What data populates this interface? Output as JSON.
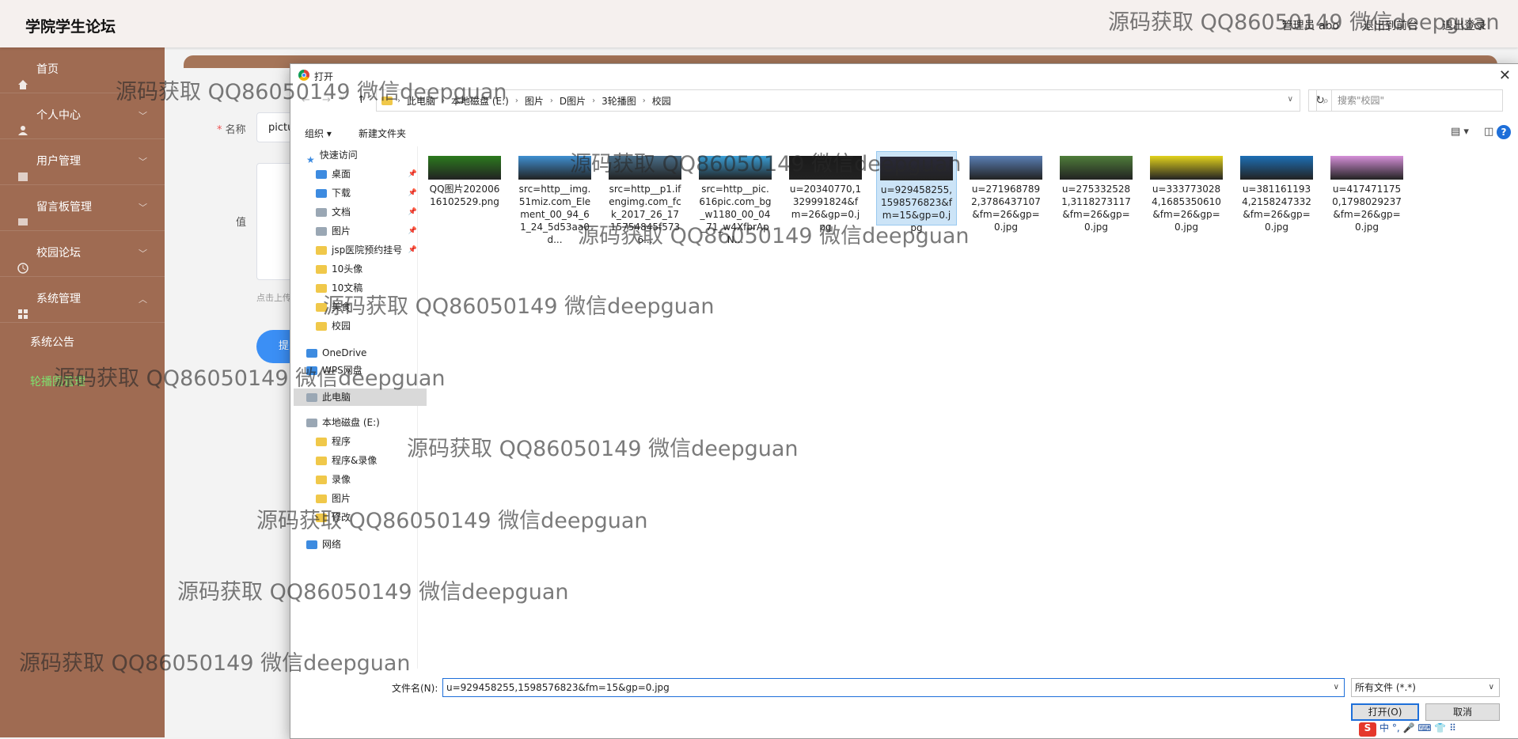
{
  "app": {
    "title": "学院学生论坛"
  },
  "topnav": {
    "user": "管理员 abo",
    "back_to_front": "退出到前台",
    "logout": "退出登录"
  },
  "sidebar": {
    "items": [
      {
        "label": "首页",
        "icon": "home-icon"
      },
      {
        "label": "个人中心",
        "icon": "user-icon"
      },
      {
        "label": "用户管理",
        "icon": "users-icon"
      },
      {
        "label": "留言板管理",
        "icon": "message-icon"
      },
      {
        "label": "校园论坛",
        "icon": "forum-icon"
      },
      {
        "label": "系统管理",
        "icon": "grid-icon"
      }
    ],
    "sub_items": [
      {
        "label": "系统公告",
        "active": false
      },
      {
        "label": "轮播图管理",
        "active": true
      }
    ]
  },
  "form": {
    "name_label": "名称",
    "name_value": "pictu",
    "value_label": "值",
    "upload_hint": "点击上传",
    "submit_label": "提"
  },
  "dialog": {
    "title": "打开",
    "breadcrumb": [
      "此电脑",
      "本地磁盘 (E:)",
      "图片",
      "D图片",
      "3轮播图",
      "校园"
    ],
    "search_placeholder": "搜索\"校园\"",
    "organize": "组织",
    "new_folder": "新建文件夹",
    "tree": [
      {
        "label": "快速访问",
        "type": "star",
        "level": 0,
        "pinned": false
      },
      {
        "label": "桌面",
        "type": "blue",
        "level": 1,
        "pinned": true
      },
      {
        "label": "下载",
        "type": "blue",
        "level": 1,
        "pinned": true
      },
      {
        "label": "文档",
        "type": "gray",
        "level": 1,
        "pinned": true
      },
      {
        "label": "图片",
        "type": "gray",
        "level": 1,
        "pinned": true
      },
      {
        "label": "jsp医院预约挂号",
        "type": "yellow",
        "level": 1,
        "pinned": true
      },
      {
        "label": "10头像",
        "type": "yellow",
        "level": 1,
        "pinned": false
      },
      {
        "label": "10文稿",
        "type": "yellow",
        "level": 1,
        "pinned": false
      },
      {
        "label": "美食",
        "type": "yellow",
        "level": 1,
        "pinned": false
      },
      {
        "label": "校园",
        "type": "yellow",
        "level": 1,
        "pinned": false
      },
      {
        "label": "OneDrive",
        "type": "blue",
        "level": 0,
        "pinned": false
      },
      {
        "label": "WPS网盘",
        "type": "blue",
        "level": 0,
        "pinned": false
      },
      {
        "label": "此电脑",
        "type": "gray",
        "level": 0,
        "pinned": false,
        "selected": true
      },
      {
        "label": "本地磁盘 (E:)",
        "type": "gray",
        "level": 0,
        "pinned": false
      },
      {
        "label": "程序",
        "type": "yellow",
        "level": 1,
        "pinned": false
      },
      {
        "label": "程序&录像",
        "type": "yellow",
        "level": 1,
        "pinned": false
      },
      {
        "label": "录像",
        "type": "yellow",
        "level": 1,
        "pinned": false
      },
      {
        "label": "图片",
        "type": "yellow",
        "level": 1,
        "pinned": false
      },
      {
        "label": "修改",
        "type": "yellow",
        "level": 1,
        "pinned": false
      },
      {
        "label": "网络",
        "type": "blue",
        "level": 0,
        "pinned": false
      }
    ],
    "files": [
      {
        "name": "QQ图片20200616102529.png",
        "color": "#2c7a1e",
        "selected": false
      },
      {
        "name": "src=http__img.51miz.com_Element_00_94_61_24_5d53aa0d...",
        "color": "#3f8fd1",
        "selected": false
      },
      {
        "name": "src=http__p1.ifengimg.com_fck_2017_26_1715754845f5736...",
        "color": "#4a6f8a",
        "selected": false
      },
      {
        "name": "src=http__pic.616pic.com_bg_w1180_00_04_71_w4XfbrApN...",
        "color": "#3aa0d8",
        "selected": false
      },
      {
        "name": "u=20340770,1329991824&fm=26&gp=0.jpg",
        "color": "#1a1a1a",
        "selected": false
      },
      {
        "name": "u=929458255,1598576823&fm=15&gp=0.jpg",
        "color": "#2a2a3a",
        "selected": true
      },
      {
        "name": "u=2719687892,3786437107&fm=26&gp=0.jpg",
        "color": "#5a7fb5",
        "selected": false
      },
      {
        "name": "u=2753325281,3118273117&fm=26&gp=0.jpg",
        "color": "#4f7d3a",
        "selected": false
      },
      {
        "name": "u=3337730284,1685350610&fm=26&gp=0.jpg",
        "color": "#e2d21c",
        "selected": false
      },
      {
        "name": "u=3811611934,2158247332&fm=26&gp=0.jpg",
        "color": "#1d6fb5",
        "selected": false
      },
      {
        "name": "u=4174711750,1798029237&fm=26&gp=0.jpg",
        "color": "#d58fd8",
        "selected": false
      }
    ],
    "filename_label": "文件名(N):",
    "filename_value": "u=929458255,1598576823&fm=15&gp=0.jpg",
    "filetype_value": "所有文件 (*.*)",
    "open_label": "打开(O)",
    "cancel_label": "取消",
    "ime_text": "中 °, 🎤 ⌨ 👕 ⠿"
  },
  "watermark": {
    "text": "源码获取 QQ86050149 微信deepguan"
  }
}
